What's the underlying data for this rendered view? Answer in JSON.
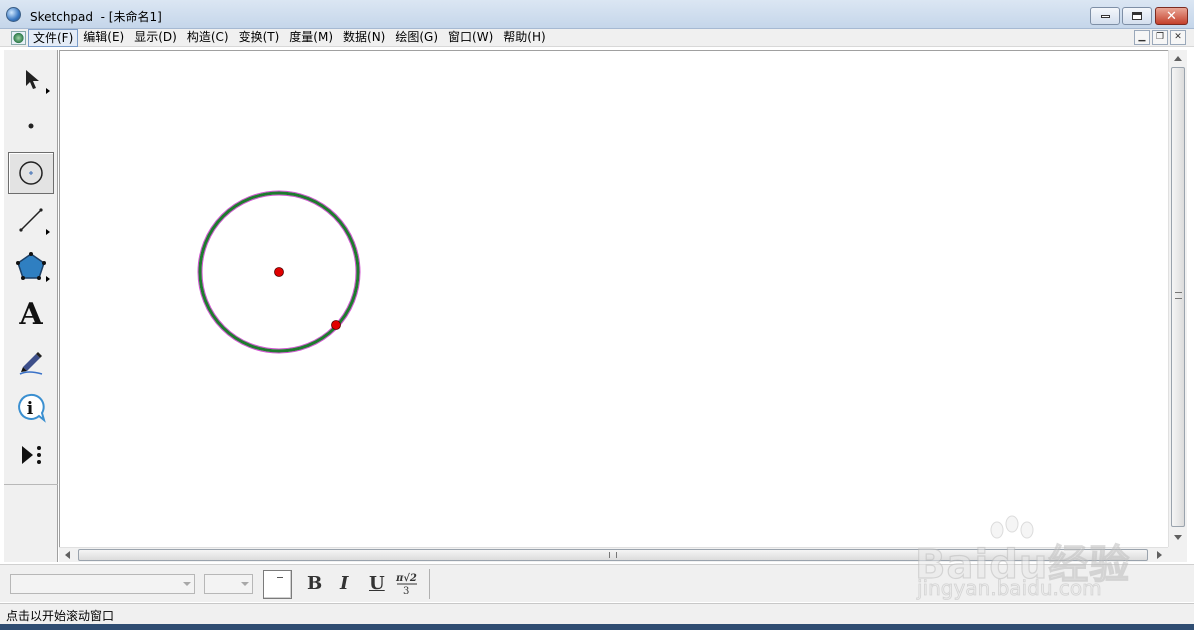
{
  "window": {
    "title": "Sketchpad  - [未命名1]"
  },
  "menu": {
    "items": [
      "文件(F)",
      "编辑(E)",
      "显示(D)",
      "构造(C)",
      "变换(T)",
      "度量(M)",
      "数据(N)",
      "绘图(G)",
      "窗口(W)",
      "帮助(H)"
    ],
    "active_index": 0
  },
  "toolbox": {
    "tools": [
      {
        "name": "selection-arrow-tool",
        "icon": "arrow-pointer-icon"
      },
      {
        "name": "point-tool",
        "icon": "point-icon"
      },
      {
        "name": "compass-tool",
        "icon": "circle-compass-icon",
        "selected": true
      },
      {
        "name": "straightedge-tool",
        "icon": "line-segment-icon"
      },
      {
        "name": "polygon-tool",
        "icon": "pentagon-icon"
      },
      {
        "name": "text-tool",
        "icon": "letter-a-icon",
        "glyph": "A"
      },
      {
        "name": "marker-tool",
        "icon": "marker-pen-icon"
      },
      {
        "name": "information-tool",
        "icon": "info-bubble-icon",
        "glyph": "i"
      },
      {
        "name": "custom-tool",
        "icon": "custom-tool-play-icon"
      }
    ]
  },
  "canvas": {
    "objects": [
      {
        "type": "circle",
        "stroke": "#1e7a2e",
        "highlight": "#d24fd2",
        "selected": true
      },
      {
        "type": "point",
        "role": "center",
        "color": "#e00000"
      },
      {
        "type": "point",
        "role": "radius-point",
        "color": "#e00000"
      }
    ]
  },
  "textbar": {
    "font_family_value": "",
    "font_size_value": "",
    "bold": "B",
    "italic": "I",
    "underline": "U",
    "math_format_icon": "math-notation-icon"
  },
  "status": {
    "text": "点击以开始滚动窗口"
  },
  "watermark": {
    "brand": "Baidu经验",
    "url": "jingyan.baidu.com"
  },
  "colors": {
    "titlebar": "#c5d6ea",
    "chrome": "#f0f0f0",
    "circle": "#1e7a2e",
    "selection": "#d24fd2",
    "point": "#e00000"
  }
}
